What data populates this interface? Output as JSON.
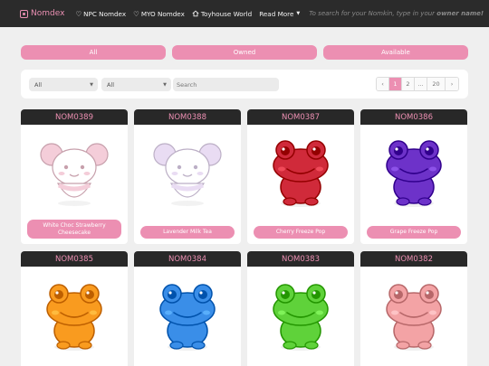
{
  "navbar": {
    "brand": "Nomdex",
    "links": [
      {
        "label": "NPC Nomdex",
        "icon": "heart-outline-icon"
      },
      {
        "label": "MYO Nomdex",
        "icon": "heart-outline-icon"
      },
      {
        "label": "Toyhouse World",
        "icon": "house-icon"
      },
      {
        "label": "Read More",
        "icon": "caret-down-icon"
      }
    ],
    "search_prefix": "To search for your Nomkin, type in your ",
    "search_emphasis": "owner name!"
  },
  "filter_tabs": [
    "All",
    "Owned",
    "Available"
  ],
  "search_panel": {
    "select_1": "All",
    "select_2": "All",
    "search_placeholder": "Search",
    "pagination": {
      "prev": "‹",
      "pages": [
        "1",
        "2",
        "...",
        "20"
      ],
      "current": "1",
      "next": "›"
    }
  },
  "cards": [
    {
      "id": "NOM0389",
      "name": "White Choc Strawberry Cheesecake",
      "color": "#f4cdd9",
      "species": "mouse"
    },
    {
      "id": "NOM0388",
      "name": "Lavender Milk Tea",
      "color": "#e9dcf3",
      "species": "mouse"
    },
    {
      "id": "NOM0387",
      "name": "Cherry Freeze Pop",
      "color": "#d02a3a",
      "species": "frog"
    },
    {
      "id": "NOM0386",
      "name": "Grape Freeze Pop",
      "color": "#6d32c9",
      "species": "frog"
    },
    {
      "id": "NOM0385",
      "name": "",
      "color": "#f99b1f",
      "species": "frog"
    },
    {
      "id": "NOM0384",
      "name": "",
      "color": "#3a8ee8",
      "species": "frog"
    },
    {
      "id": "NOM0383",
      "name": "",
      "color": "#5fd23a",
      "species": "frog"
    },
    {
      "id": "NOM0382",
      "name": "",
      "color": "#f3a3a5",
      "species": "frog"
    }
  ],
  "accent_color": "#ec8fb2"
}
